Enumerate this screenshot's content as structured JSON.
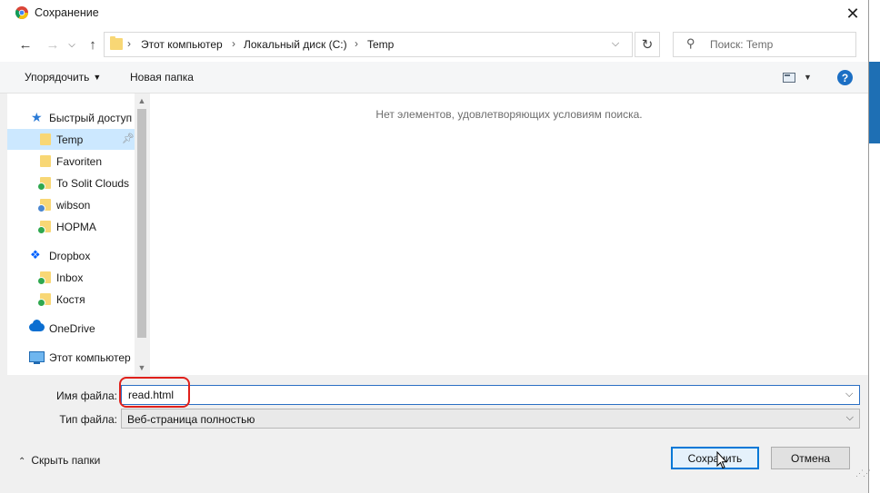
{
  "window": {
    "title": "Сохранение",
    "close_label": "✕"
  },
  "nav": {
    "back": "←",
    "forward": "→",
    "up": "↑",
    "breadcrumbs": [
      "Этот компьютер",
      "Локальный диск (C:)",
      "Temp"
    ],
    "crumb_separator": "›",
    "dropdown": "⌵",
    "refresh": "↻",
    "search_placeholder": "Поиск: Temp"
  },
  "toolbar": {
    "organize": "Упорядочить",
    "new_folder": "Новая папка",
    "help": "?"
  },
  "sidebar": {
    "quick_access": "Быстрый доступ",
    "items": [
      {
        "label": "Temp",
        "icon": "folder-icon",
        "pinned": true
      },
      {
        "label": "Favoriten",
        "icon": "folder-icon"
      },
      {
        "label": "To Solit Clouds",
        "icon": "folder-sync-icon"
      },
      {
        "label": "wibson",
        "icon": "folder-user-icon"
      },
      {
        "label": "НОРМА",
        "icon": "folder-sync-icon"
      }
    ],
    "dropbox": "Dropbox",
    "dropbox_items": [
      {
        "label": "Inbox",
        "icon": "folder-sync-icon"
      },
      {
        "label": "Костя",
        "icon": "folder-sync-icon"
      }
    ],
    "onedrive": "OneDrive",
    "this_pc": "Этот компьютер"
  },
  "content": {
    "empty_message": "Нет элементов, удовлетворяющих условиям поиска."
  },
  "form": {
    "filename_label": "Имя файла:",
    "filename_value": "read.html",
    "filetype_label": "Тип файла:",
    "filetype_value": "Веб-страница полностью"
  },
  "footer": {
    "hide_folders": "Скрыть папки",
    "save": "Сохранить",
    "cancel": "Отмена"
  },
  "colors": {
    "accent": "#0078d7",
    "highlight": "#e0201b",
    "selected": "#cce8ff"
  }
}
